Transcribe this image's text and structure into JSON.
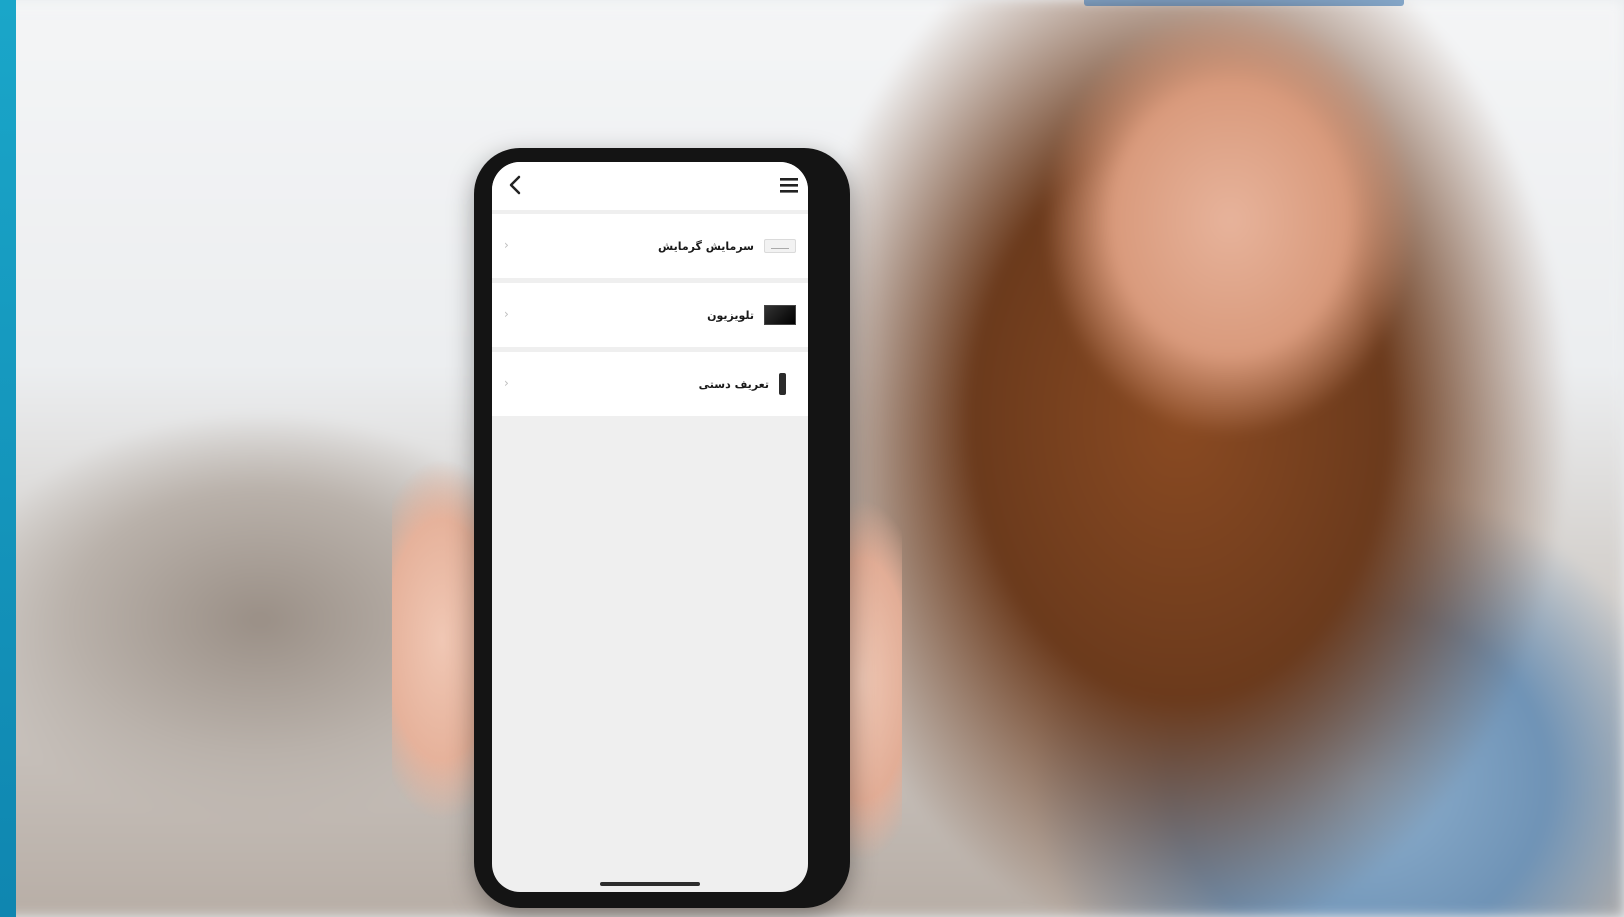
{
  "topbar": {
    "back_icon": "chevron-left-icon",
    "menu_icon": "hamburger-menu-icon"
  },
  "devices": [
    {
      "label": "سرمایش گرمایش",
      "thumb": "air-conditioner-icon"
    },
    {
      "label": "تلویزیون",
      "thumb": "tv-icon"
    },
    {
      "label": "تعریف دستی",
      "thumb": "remote-control-icon"
    }
  ],
  "colors": {
    "accent_stripe": "#1aa6c9",
    "phone_frame": "#141414",
    "screen_bg": "#efefef"
  }
}
